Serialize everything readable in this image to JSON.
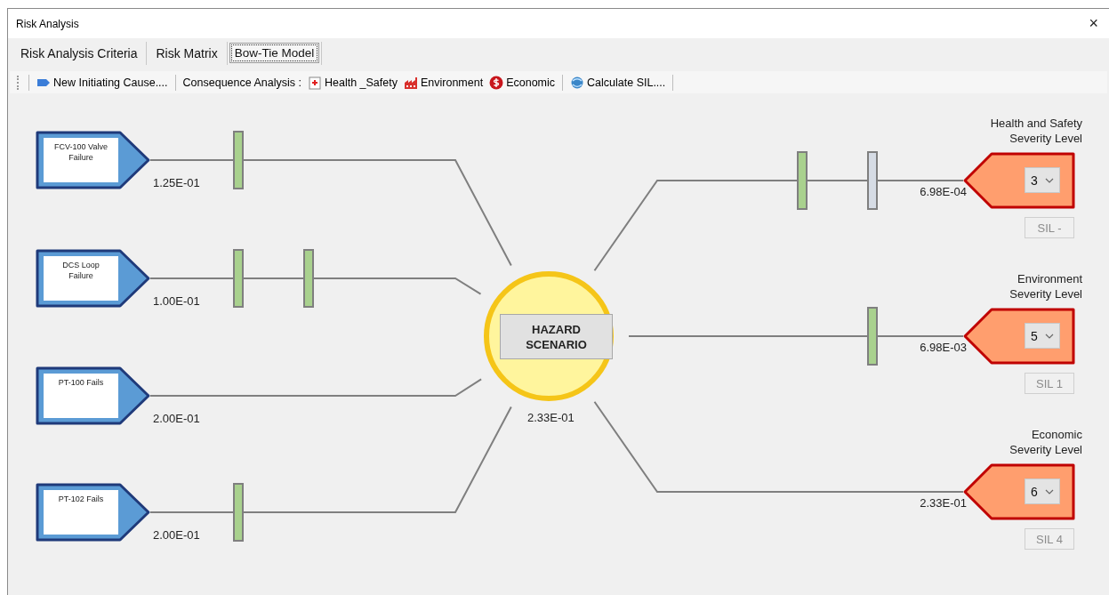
{
  "window": {
    "title": "Risk Analysis",
    "close": "×"
  },
  "tabs": [
    {
      "label": "Risk Analysis Criteria",
      "selected": false
    },
    {
      "label": "Risk Matrix",
      "selected": false
    },
    {
      "label": "Bow-Tie Model",
      "selected": true
    }
  ],
  "toolbar": [
    {
      "kind": "button",
      "label": "New Initiating Cause...."
    },
    {
      "kind": "separator"
    },
    {
      "kind": "text",
      "label": "Consequence Analysis :"
    },
    {
      "kind": "button",
      "label": "Health _Safety"
    },
    {
      "kind": "button",
      "label": "Environment"
    },
    {
      "kind": "button",
      "label": "Economic"
    },
    {
      "kind": "separator"
    },
    {
      "kind": "button",
      "label": "Calculate SIL...."
    },
    {
      "kind": "separator"
    }
  ],
  "causes": [
    {
      "label": "FCV-100 Valve Failure",
      "frequency": "1.25E-01",
      "barriers": [
        {
          "color": "#a9d18e"
        }
      ]
    },
    {
      "label": "DCS Loop Failure",
      "frequency": "1.00E-01",
      "barriers": [
        {
          "color": "#a9d18e"
        },
        {
          "color": "#a9d18e"
        }
      ]
    },
    {
      "label": "PT-100 Fails",
      "frequency": "2.00E-01"
    },
    {
      "label": "PT-102 Fails",
      "frequency": "2.00E-01",
      "barriers": [
        {
          "color": "#a9d18e"
        }
      ]
    }
  ],
  "hazard": {
    "label": "HAZARD SCENARIO",
    "frequency": "2.33E-01"
  },
  "consequences": [
    {
      "title": "Health and Safety\nSeverity Level",
      "severity": "3",
      "frequency": "6.98E-04",
      "sil": "SIL -",
      "barriers": [
        {
          "color": "#a9d18e"
        },
        {
          "color": "#d6dce5"
        }
      ]
    },
    {
      "title": "Environment\nSeverity Level",
      "severity": "5",
      "frequency": "6.98E-03",
      "sil": "SIL 1",
      "barriers": [
        {
          "color": "#a9d18e"
        }
      ]
    },
    {
      "title": "Economic\nSeverity Level",
      "severity": "6",
      "frequency": "2.33E-01",
      "sil": "SIL 4"
    }
  ]
}
